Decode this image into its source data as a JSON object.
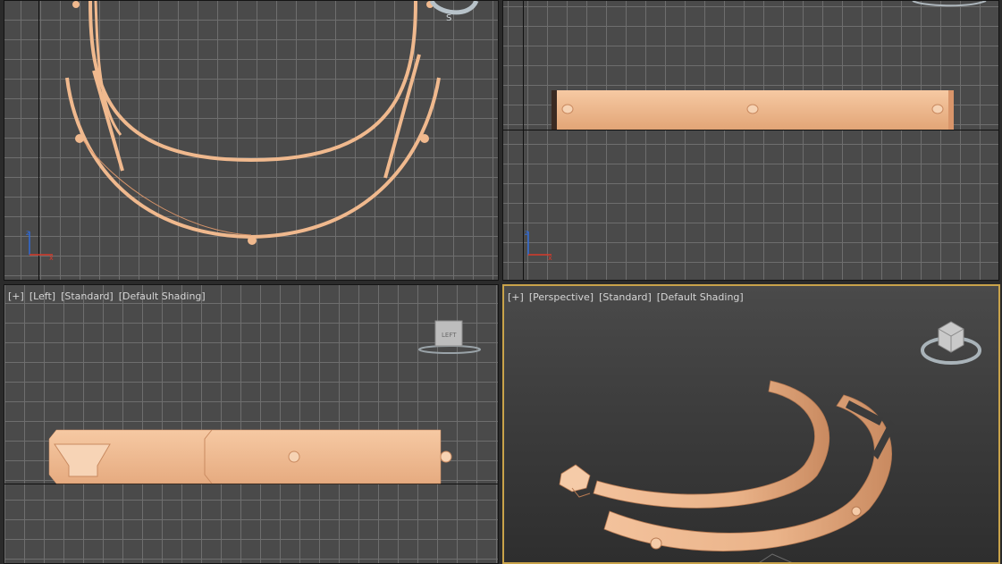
{
  "viewports": {
    "top_left": {
      "label": []
    },
    "top_right": {
      "label": []
    },
    "bottom_left": {
      "label": [
        "[+]",
        "[Left]",
        "[Standard]",
        "[Default Shading]"
      ],
      "viewcube_face": "LEFT"
    },
    "bottom_right": {
      "label": [
        "[+]",
        "[Perspective]",
        "[Standard]",
        "[Default Shading]"
      ],
      "active": true
    }
  },
  "compass": {
    "south": "S"
  },
  "colors": {
    "model": "#f0b98e",
    "model_shade": "#d9956a",
    "grid_bg": "#4a4a4a",
    "grid_line": "#6e6e6e",
    "active_border": "#c9a34a",
    "label_text": "#d6d6d6"
  },
  "icons": [
    "viewcube-icon",
    "axis-tripod-icon",
    "compass-ring-icon"
  ]
}
